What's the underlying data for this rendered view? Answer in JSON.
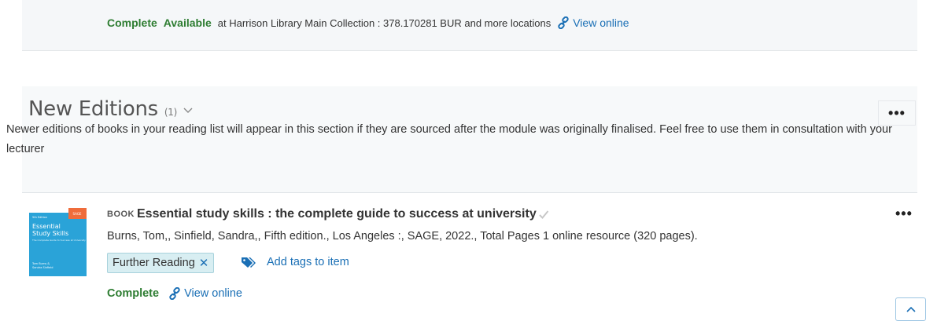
{
  "top_item": {
    "status": "Complete",
    "availability": "Available",
    "location": "at Harrison Library Main Collection : 378.170281 BUR and more locations",
    "view_online": "View online"
  },
  "section": {
    "title": "New Editions",
    "count": "(1)",
    "description": "Newer editions of books in your reading list will appear in this section if they are sourced after the module was originally finalised. Feel free to use them in consultation with your lecturer"
  },
  "item": {
    "type": "BOOK",
    "title": "Essential study skills : the complete guide to success at university",
    "details": "Burns, Tom,, Sinfield, Sandra,, Fifth edition., Los Angeles :, SAGE, 2022., Total Pages 1 online resource (320 pages).",
    "tag": "Further Reading",
    "add_tags": "Add tags to item",
    "status": "Complete",
    "view_online": "View online",
    "cover": {
      "edition_label": "5th Edition",
      "corner_label": "SAGE",
      "title_line1": "Essential",
      "title_line2": "Study Skills",
      "subtitle": "The Complete Guide to Success at University",
      "authors_line1": "Tom Burns &",
      "authors_line2": "Sandra Sinfield"
    }
  },
  "more_label": "•••",
  "colors": {
    "green": "#2e7d32",
    "link": "#1a6fb5",
    "tag_bg": "#d8eef2"
  }
}
